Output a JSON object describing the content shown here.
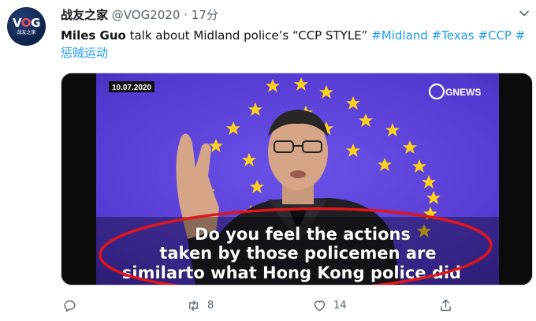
{
  "tweet": {
    "avatar": {
      "logo": "VOG",
      "caption": "战友之家"
    },
    "display_name": "战友之家",
    "handle": "@VOG2020",
    "separator": "·",
    "timestamp": "17分",
    "text": {
      "author": "Miles Guo",
      "body": " talk about Midland police’s “CCP STYLE” ",
      "hashtags": [
        "#Midland",
        "#Texas",
        "#CCP",
        "#",
        "惩贼运动"
      ]
    },
    "media": {
      "date_stamp": "10.07.2020",
      "channel_logo": "GNEWS",
      "subtitle_lines": [
        "Do you feel the actions",
        "taken by those policemen are",
        "similarto what Hong Kong police did"
      ],
      "annotation_color": "#e0161b",
      "background_color": "#5a3fd6"
    },
    "actions": {
      "reply_count": "",
      "retweet_count": "8",
      "like_count": "14"
    },
    "colors": {
      "link": "#1d9bf0",
      "muted": "#536471"
    }
  }
}
